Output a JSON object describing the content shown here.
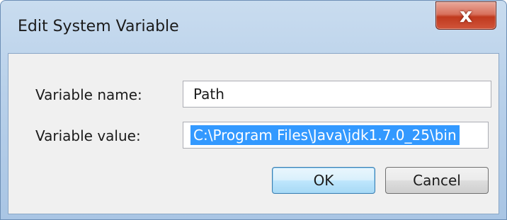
{
  "dialog": {
    "title": "Edit System Variable",
    "close_glyph": "x",
    "close_icon": "close-icon"
  },
  "form": {
    "name_label": "Variable name:",
    "name_value": "Path",
    "value_label": "Variable value:",
    "value_value": "C:\\Program Files\\Java\\jdk1.7.0_25\\bin"
  },
  "buttons": {
    "ok_label": "OK",
    "cancel_label": "Cancel"
  },
  "colors": {
    "selection": "#3399ff",
    "close_button": "#c0391e",
    "title_bar": "#b9d1ea"
  }
}
